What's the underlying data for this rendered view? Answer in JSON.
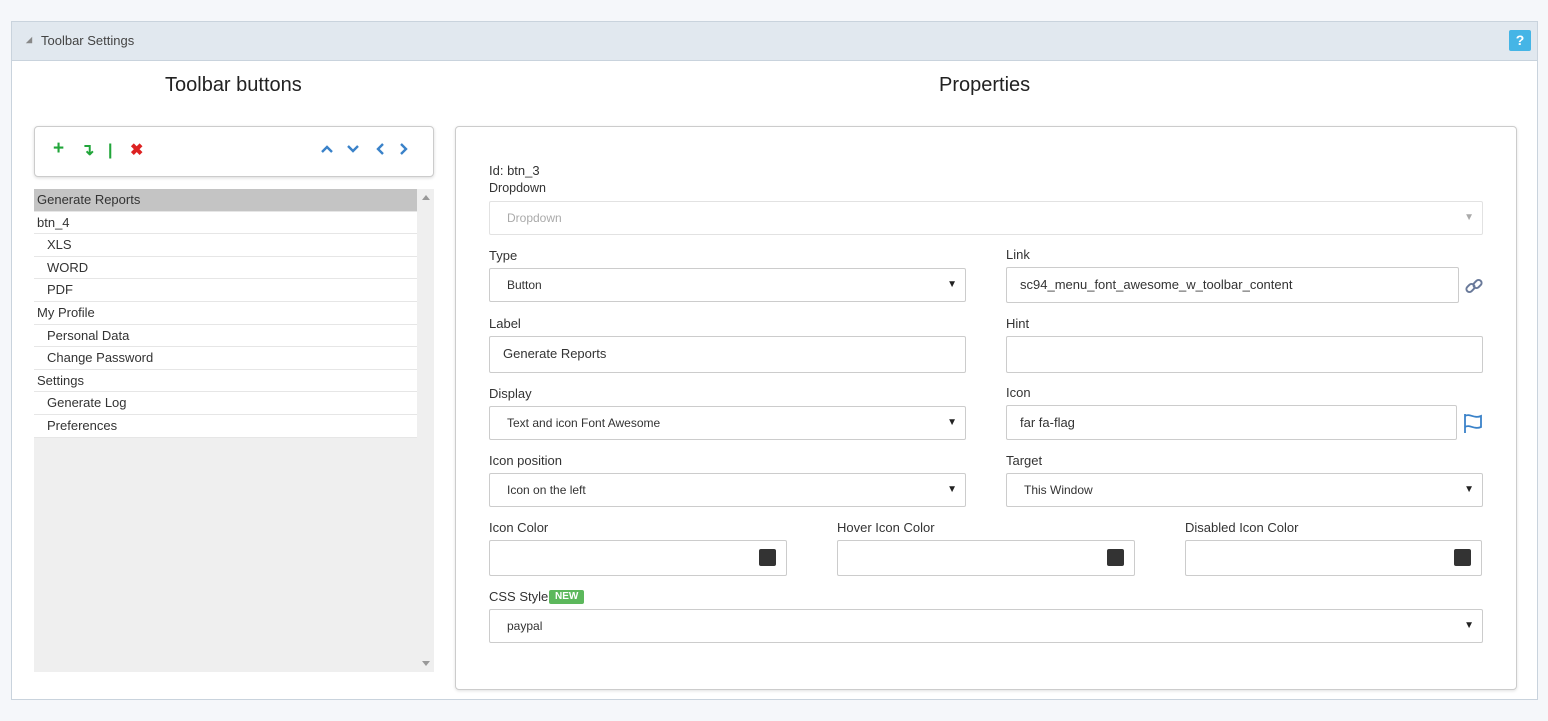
{
  "header": {
    "title": "Toolbar Settings",
    "help_label": "?"
  },
  "left": {
    "title": "Toolbar buttons",
    "toolbar_icons": [
      "add-icon",
      "insert-sub-icon",
      "separator-icon",
      "delete-icon",
      "move-up-icon",
      "move-down-icon",
      "move-left-icon",
      "move-right-icon"
    ],
    "tree_items": [
      {
        "label": "Generate Reports",
        "level": 0,
        "selected": true
      },
      {
        "label": "btn_4",
        "level": 0
      },
      {
        "label": "XLS",
        "level": 1
      },
      {
        "label": "WORD",
        "level": 1
      },
      {
        "label": "PDF",
        "level": 1
      },
      {
        "label": "My Profile",
        "level": 0
      },
      {
        "label": "Personal Data",
        "level": 1
      },
      {
        "label": "Change Password",
        "level": 1
      },
      {
        "label": "Settings",
        "level": 0
      },
      {
        "label": "Generate Log",
        "level": 1
      },
      {
        "label": "Preferences",
        "level": 1
      }
    ]
  },
  "props": {
    "title": "Properties",
    "id_text": "Id: btn_3",
    "dropdown": {
      "label": "Dropdown",
      "placeholder": "Dropdown"
    },
    "type": {
      "label": "Type",
      "value": "Button"
    },
    "link": {
      "label": "Link",
      "value": "sc94_menu_font_awesome_w_toolbar_content"
    },
    "label_field": {
      "label": "Label",
      "value": "Generate Reports"
    },
    "hint": {
      "label": "Hint",
      "value": ""
    },
    "display": {
      "label": "Display",
      "value": "Text and icon Font Awesome"
    },
    "icon": {
      "label": "Icon",
      "value": "far fa-flag"
    },
    "icon_position": {
      "label": "Icon position",
      "value": "Icon on the left"
    },
    "target": {
      "label": "Target",
      "value": "This Window"
    },
    "icon_color": {
      "label": "Icon Color",
      "value": ""
    },
    "hover_icon_color": {
      "label": "Hover Icon Color",
      "value": ""
    },
    "disabled_icon_color": {
      "label": "Disabled Icon Color",
      "value": ""
    },
    "css_style": {
      "label": "CSS Style",
      "badge": "NEW",
      "value": "paypal"
    }
  },
  "colors": {
    "accent": "#45b5e6",
    "green": "#21a53a",
    "red": "#dd2222",
    "blue": "#3a82c9",
    "badge": "#5cb85c"
  }
}
